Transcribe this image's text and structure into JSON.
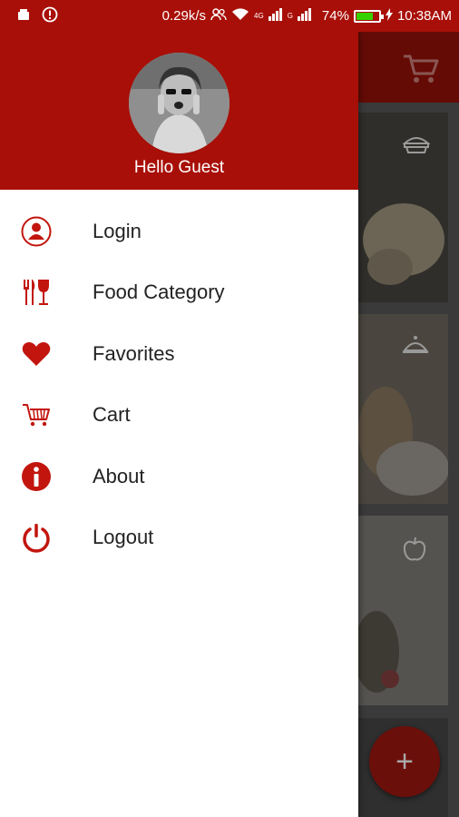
{
  "status_bar": {
    "speed": "0.29k/s",
    "net_4g": "4G",
    "net_g": "G",
    "battery_percent": "74%",
    "battery_level": 0.74,
    "time": "10:38AM"
  },
  "drawer": {
    "greeting": "Hello Guest",
    "items": [
      {
        "label": "Login",
        "icon": "user-icon"
      },
      {
        "label": "Food Category",
        "icon": "cutlery-glass-icon"
      },
      {
        "label": "Favorites",
        "icon": "heart-icon"
      },
      {
        "label": "Cart",
        "icon": "cart-icon"
      },
      {
        "label": "About",
        "icon": "info-icon"
      },
      {
        "label": "Logout",
        "icon": "power-icon"
      }
    ]
  },
  "background": {
    "fab_label": "+"
  },
  "colors": {
    "brand": "#a80f08",
    "accent": "#c2150e"
  }
}
